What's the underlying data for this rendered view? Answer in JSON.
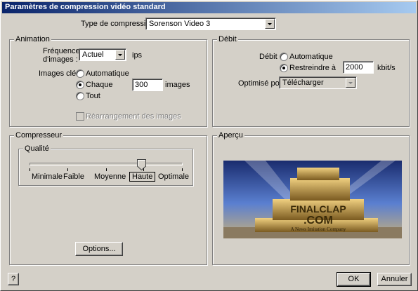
{
  "window": {
    "title": "Paramètres de compression vidéo standard"
  },
  "compression": {
    "label": "Type de compression :",
    "value": "Sorenson Video 3"
  },
  "animation": {
    "title": "Animation",
    "frame_rate_label_line1": "Fréquence",
    "frame_rate_label_line2": "d'images :",
    "frame_rate_value": "Actuel",
    "frame_rate_unit": "ips",
    "keyframes_label": "Images clés :",
    "keyframes_options": [
      "Automatique",
      "Chaque",
      "Tout"
    ],
    "keyframes_selected": "Chaque",
    "keyframes_every_value": "300",
    "keyframes_every_unit": "images",
    "reorder_label": "Réarrangement des images"
  },
  "bitrate": {
    "title": "Débit",
    "label": "Débit :",
    "options": [
      "Automatique",
      "Restreindre à"
    ],
    "selected": "Restreindre à",
    "limit_value": "2000",
    "limit_unit": "kbit/s",
    "optimize_label": "Optimisé pour :",
    "optimize_value": "Télécharger"
  },
  "compressor": {
    "title": "Compresseur",
    "quality_title": "Qualité",
    "quality_levels": [
      "Minimale",
      "Faible",
      "Moyenne",
      "Haute",
      "Optimale"
    ],
    "quality_selected": "Haute",
    "options_button": "Options..."
  },
  "preview": {
    "title": "Aperçu",
    "logo_line1": "FINALCLAP",
    "logo_line2": ".COM",
    "logo_tagline": "A News Imitation Company"
  },
  "footer": {
    "help_button": "?",
    "ok_button": "OK",
    "cancel_button": "Annuler"
  },
  "colors": {
    "title_start": "#0a246a",
    "title_end": "#a6caf0",
    "face": "#d4d0c8"
  }
}
